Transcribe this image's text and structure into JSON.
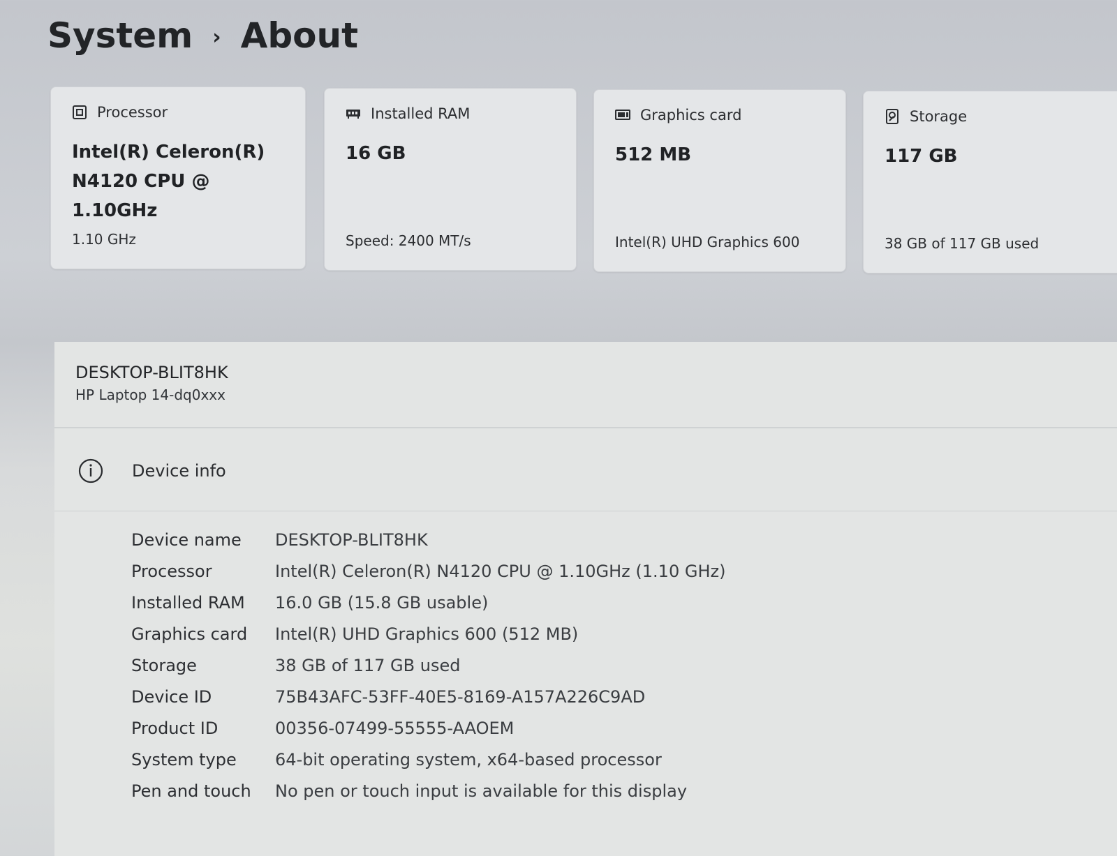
{
  "breadcrumb": {
    "parent": "System",
    "current": "About",
    "separator": "›"
  },
  "cards": [
    {
      "icon": "processor-icon",
      "label": "Processor",
      "main": [
        "Intel(R) Celeron(R)",
        "N4120 CPU @ 1.10GHz"
      ],
      "sub": "1.10 GHz"
    },
    {
      "icon": "ram-icon",
      "label": "Installed RAM",
      "main": [
        "16 GB"
      ],
      "sub": "Speed: 2400 MT/s"
    },
    {
      "icon": "graphics-card-icon",
      "label": "Graphics card",
      "main": [
        "512 MB"
      ],
      "sub": "Intel(R) UHD Graphics 600"
    },
    {
      "icon": "storage-icon",
      "label": "Storage",
      "main": [
        "117 GB"
      ],
      "sub": "38 GB of 117 GB used"
    }
  ],
  "device": {
    "name": "DESKTOP-BLIT8HK",
    "model": "HP Laptop 14-dq0xxx"
  },
  "device_info": {
    "title": "Device info",
    "icon": "info-icon",
    "rows": [
      {
        "label": "Device name",
        "value": "DESKTOP-BLIT8HK"
      },
      {
        "label": "Processor",
        "value": "Intel(R) Celeron(R) N4120 CPU @ 1.10GHz (1.10 GHz)"
      },
      {
        "label": "Installed RAM",
        "value": "16.0 GB (15.8 GB usable)"
      },
      {
        "label": "Graphics card",
        "value": "Intel(R) UHD Graphics 600 (512 MB)"
      },
      {
        "label": "Storage",
        "value": "38 GB of 117 GB used"
      },
      {
        "label": "Device ID",
        "value": "75B43AFC-53FF-40E5-8169-A157A226C9AD"
      },
      {
        "label": "Product ID",
        "value": "00356-07499-55555-AAOEM"
      },
      {
        "label": "System type",
        "value": "64-bit operating system, x64-based processor"
      },
      {
        "label": "Pen and touch",
        "value": "No pen or touch input is available for this display"
      }
    ]
  }
}
